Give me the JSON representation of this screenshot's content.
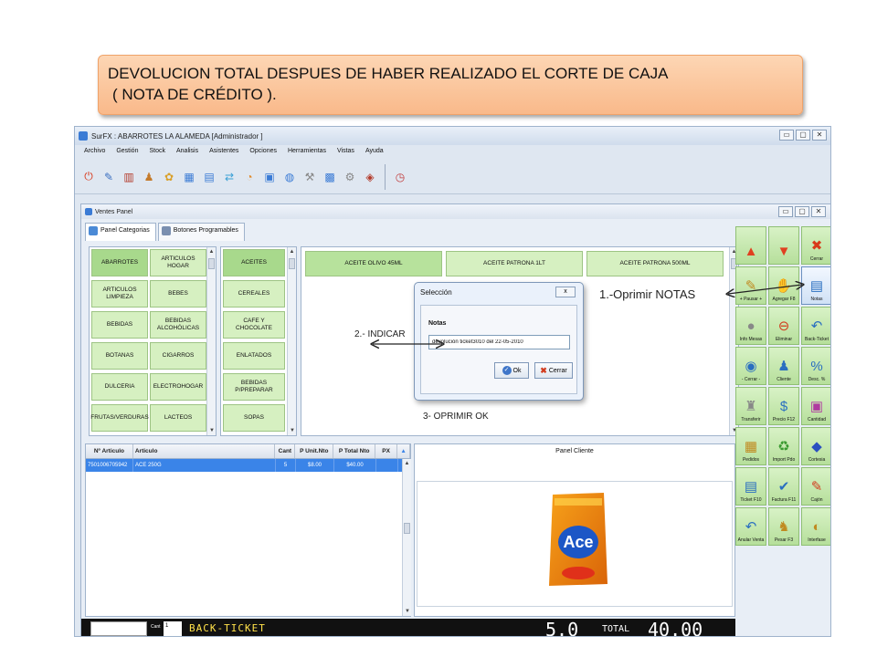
{
  "banner": {
    "line1": "DEVOLUCION TOTAL DESPUES DE HABER REALIZADO EL CORTE DE CAJA",
    "line2": "( NOTA DE CRÉDITO )."
  },
  "app": {
    "title": "SurFX : ABARROTES LA ALAMEDA [Administrador ]",
    "menu": [
      "Archivo",
      "Gestión",
      "Stock",
      "Analisis",
      "Asistentes",
      "Opciones",
      "Herramientas",
      "Vistas",
      "Ayuda"
    ]
  },
  "child": {
    "title": "Ventes Panel",
    "tabs": [
      "Panel Categorias",
      "Botones Programables"
    ]
  },
  "categories": [
    "ABARROTES",
    "ARTICULOS HOGAR",
    "ARTICULOS LIMPIEZA",
    "BEBES",
    "BEBIDAS",
    "BEBIDAS ALCOHÓLICAS",
    "BOTANAS",
    "CIGARROS",
    "DULCERIA",
    "ELECTROHOGAR",
    "FRUTAS/VERDURAS",
    "LACTEOS"
  ],
  "subcategories": [
    "ACEITES",
    "CEREALES",
    "CAFE Y CHOCOLATE",
    "ENLATADOS",
    "BEBIDAS P/PREPARAR",
    "SOPAS"
  ],
  "products": [
    "ACEITE OLIVO 45ML",
    "ACEITE PATRONA 1LT",
    "ACEITE PATRONA 500ML"
  ],
  "commands": [
    {
      "label": "",
      "icon": "▲",
      "color": "#e04020"
    },
    {
      "label": "",
      "icon": "▼",
      "color": "#e04020"
    },
    {
      "label": "Cerrar",
      "icon": "✖",
      "color": "#d83a1a"
    },
    {
      "label": "+ Pausar +",
      "icon": "✎",
      "color": "#c08a20"
    },
    {
      "label": "Agregar F8",
      "icon": "✋",
      "color": "#c08a20"
    },
    {
      "label": "Notas",
      "icon": "▤",
      "color": "#2a6fc0"
    },
    {
      "label": "Info Mesas",
      "icon": "●",
      "color": "#888888"
    },
    {
      "label": "Eliminar",
      "icon": "⊖",
      "color": "#d23c1e"
    },
    {
      "label": "Back-Ticket",
      "icon": "↶",
      "color": "#2a6fc0"
    },
    {
      "label": "- Cerrar -",
      "icon": "◉",
      "color": "#2a6fc0"
    },
    {
      "label": "Cliente",
      "icon": "♟",
      "color": "#2a6fc0"
    },
    {
      "label": "Desc. %",
      "icon": "%",
      "color": "#2a6fc0"
    },
    {
      "label": "Transferir",
      "icon": "♜",
      "color": "#888888"
    },
    {
      "label": "Precio F12",
      "icon": "$",
      "color": "#2a6fc0"
    },
    {
      "label": "Cantidad",
      "icon": "▣",
      "color": "#b03aa0"
    },
    {
      "label": "Pedidos",
      "icon": "▦",
      "color": "#c08a20"
    },
    {
      "label": "Import Pdo",
      "icon": "♻",
      "color": "#3a9a30"
    },
    {
      "label": "Cortesia",
      "icon": "◆",
      "color": "#2a4fc0"
    },
    {
      "label": "Ticket F10",
      "icon": "▤",
      "color": "#2a6fc0"
    },
    {
      "label": "Factura F11",
      "icon": "✔",
      "color": "#2a6fc0"
    },
    {
      "label": "Cajón",
      "icon": "✎",
      "color": "#d23c1e"
    },
    {
      "label": "Anular Venta",
      "icon": "↶",
      "color": "#2a6fc0"
    },
    {
      "label": "Pesar F3",
      "icon": "♞",
      "color": "#c08a20"
    },
    {
      "label": "Interfase",
      "icon": "◐",
      "color": "#c08a20"
    }
  ],
  "table": {
    "headers": [
      "Nº Articulo",
      "Articulo",
      "Cant",
      "P Unit.Nto",
      "P Total Nto",
      "PX"
    ],
    "rows": [
      [
        "7501006705942",
        "ACE 250G",
        "5",
        "$8.00",
        "$40.00",
        ""
      ]
    ]
  },
  "client_panel": {
    "title": "Panel Cliente",
    "brand": "Ace"
  },
  "bottom": {
    "cant_label": "Cant",
    "cant_value": "1",
    "lcd": "BACK-TICKET",
    "qty": "5.0",
    "total_label": "TOTAL",
    "total": "40.00"
  },
  "dialog": {
    "title": "Selección",
    "close": "x",
    "label": "Notas",
    "input_value": "devolución ticket3010 del 22-05-2010",
    "ok": "Ok",
    "cancel": "Cerrar"
  },
  "annotations": {
    "step1": "1.-Oprimir NOTAS",
    "step2": "2.- INDICAR",
    "step3": "3- OPRIMIR OK"
  },
  "colors": {
    "banner": "#f9b98a",
    "button_green": "#d6f0c1",
    "selected_row": "#3a84e8",
    "lcd": "#ffe14a"
  }
}
